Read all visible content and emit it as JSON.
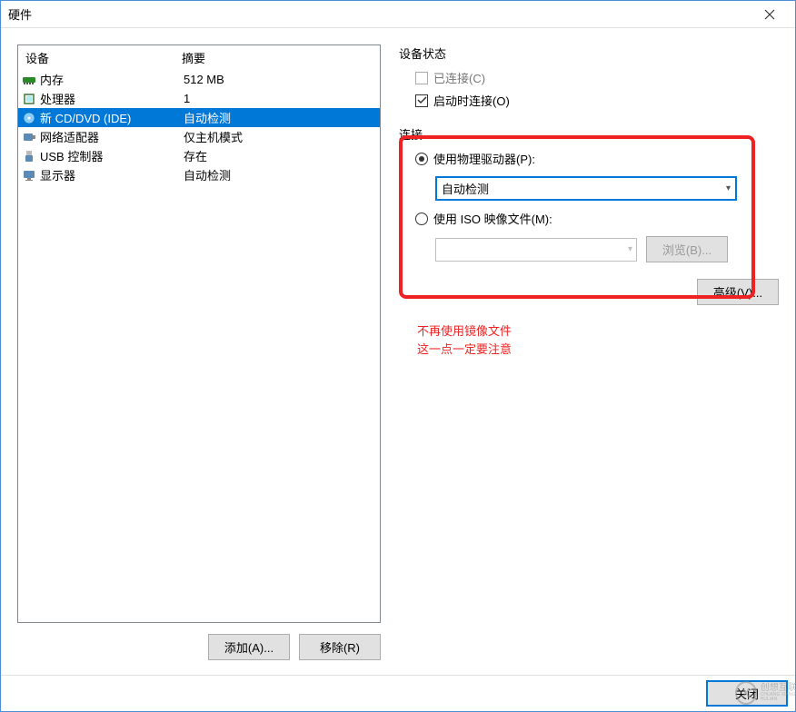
{
  "window": {
    "title": "硬件"
  },
  "deviceList": {
    "header": {
      "col1": "设备",
      "col2": "摘要"
    },
    "rows": [
      {
        "name": "内存",
        "summary": "512 MB",
        "icon": "memory"
      },
      {
        "name": "处理器",
        "summary": "1",
        "icon": "cpu"
      },
      {
        "name": "新 CD/DVD (IDE)",
        "summary": "自动检测",
        "icon": "disc",
        "selected": true
      },
      {
        "name": "网络适配器",
        "summary": "仅主机模式",
        "icon": "network"
      },
      {
        "name": "USB 控制器",
        "summary": "存在",
        "icon": "usb"
      },
      {
        "name": "显示器",
        "summary": "自动检测",
        "icon": "monitor"
      }
    ]
  },
  "buttons": {
    "add": "添加(A)...",
    "remove": "移除(R)",
    "advanced": "高级(V)...",
    "browse": "浏览(B)...",
    "close": "关闭"
  },
  "status": {
    "title": "设备状态",
    "connected": "已连接(C)",
    "connectAtPowerOn": "启动时连接(O)"
  },
  "connection": {
    "title": "连接",
    "physical": "使用物理驱动器(P):",
    "physicalValue": "自动检测",
    "iso": "使用 ISO 映像文件(M):"
  },
  "annotation": {
    "line1": "不再使用镜像文件",
    "line2": "这一点一定要注意"
  },
  "watermark": {
    "brand": "创想互联",
    "sub": "CHUANG XIANG HULIAN"
  }
}
